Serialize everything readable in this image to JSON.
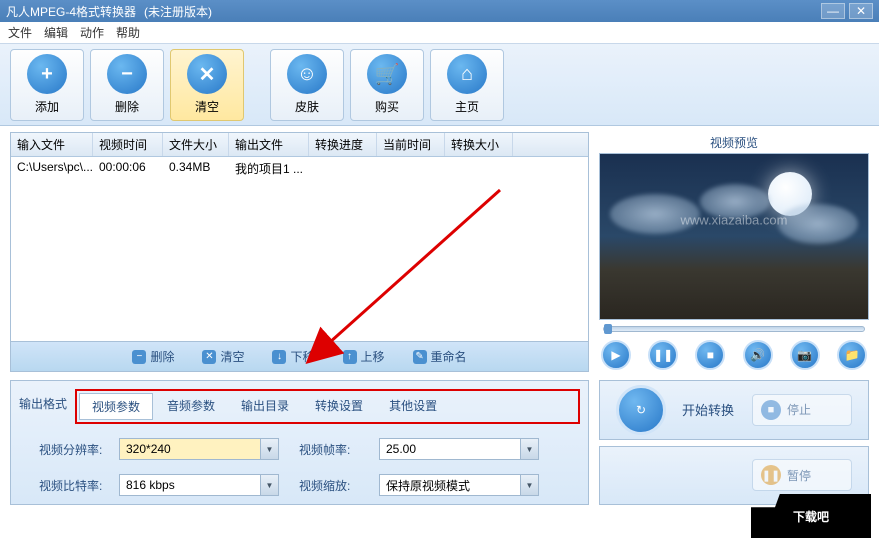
{
  "title_bar": {
    "app_name": "凡人MPEG-4格式转换器",
    "version_note": "(未注册版本)"
  },
  "menu": [
    "文件",
    "编辑",
    "动作",
    "帮助"
  ],
  "toolbar": {
    "add": "添加",
    "delete": "删除",
    "clear": "清空",
    "skin": "皮肤",
    "buy": "购买",
    "home": "主页"
  },
  "table": {
    "headers": [
      "输入文件",
      "视频时间",
      "文件大小",
      "输出文件",
      "转换进度",
      "当前时间",
      "转换大小"
    ],
    "rows": [
      {
        "input": "C:\\Users\\pc\\...",
        "duration": "00:00:06",
        "size": "0.34MB",
        "output": "我的项目1 ...",
        "progress": "",
        "curtime": "",
        "convsize": ""
      }
    ]
  },
  "list_actions": {
    "delete": "删除",
    "clear": "清空",
    "down": "下移",
    "up": "上移",
    "rename": "重命名"
  },
  "preview": {
    "title": "视频预览",
    "watermark": "www.xiazaiba.com"
  },
  "settings": {
    "out_format_label": "输出格式",
    "tabs": [
      "视频参数",
      "音频参数",
      "输出目录",
      "转换设置",
      "其他设置"
    ],
    "params": {
      "resolution_label": "视频分辨率:",
      "resolution_value": "320*240",
      "framerate_label": "视频帧率:",
      "framerate_value": "25.00",
      "bitrate_label": "视频比特率:",
      "bitrate_value": "816 kbps",
      "scale_label": "视频缩放:",
      "scale_value": "保持原视频模式"
    }
  },
  "actions": {
    "start": "开始转换",
    "stop": "停止",
    "pause": "暂停"
  },
  "logo": "下载吧"
}
